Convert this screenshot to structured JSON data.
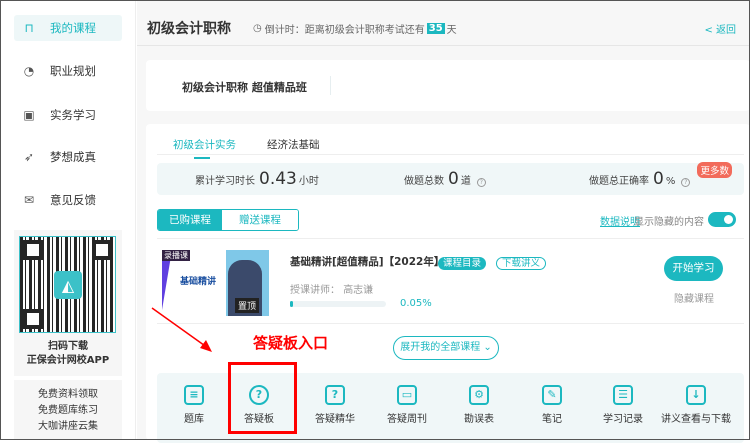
{
  "sidebar": {
    "items": [
      {
        "label": "我的课程",
        "icon": "bookmark-icon",
        "active": true
      },
      {
        "label": "职业规划",
        "icon": "chart-circle-icon"
      },
      {
        "label": "实务学习",
        "icon": "monitor-icon"
      },
      {
        "label": "梦想成真",
        "icon": "paper-plane-icon"
      },
      {
        "label": "意见反馈",
        "icon": "mail-icon"
      }
    ],
    "qr_line1": "扫码下载",
    "qr_line2": "正保会计网校APP",
    "links": [
      "免费资料领取",
      "免费题库练习",
      "大咖讲座云集"
    ]
  },
  "header": {
    "title": "初级会计职称",
    "countdown_prefix": "倒计时：距离初级会计职称考试还有",
    "days": "35",
    "days_suffix": "天",
    "back": "< 返回"
  },
  "class_name": "初级会计职称 超值精品班",
  "tabs": [
    "初级会计实务",
    "经济法基础"
  ],
  "stats": {
    "study_label": "累计学习时长",
    "study_value": "0.43",
    "study_unit": "小时",
    "total_label": "做题总数",
    "total_value": "0",
    "total_unit": "道",
    "rate_label": "做题总正确率",
    "rate_value": "0",
    "rate_unit": "%",
    "more": "更多数"
  },
  "segments": [
    "已购课程",
    "赠送课程"
  ],
  "data_link": "数据说明",
  "show_hidden": "显示隐藏的内容",
  "show_hidden_on": true,
  "course": {
    "title": "基础精讲[超值精品]【2022年】",
    "tag_catalog": "课程目录",
    "tag_download": "下载讲义",
    "teacher_label": "授课讲师：",
    "teacher": "高志谦",
    "progress": 0.05,
    "progress_text": "0.05%",
    "start": "开始学习",
    "hide": "隐藏课程",
    "thumb_pin": "置顶",
    "thumb_title": "基础精讲",
    "thumb_brand": "录播课"
  },
  "expand": "展开我的全部课程",
  "tools": [
    {
      "label": "题库",
      "icon": "question-bank-icon",
      "glyph": "≡"
    },
    {
      "label": "答疑板",
      "icon": "question-bubble-icon",
      "glyph": "?"
    },
    {
      "label": "答疑精华",
      "icon": "chat-question-icon",
      "glyph": "?"
    },
    {
      "label": "答疑周刊",
      "icon": "journal-icon",
      "glyph": "▭"
    },
    {
      "label": "勘误表",
      "icon": "gear-icon",
      "glyph": "⚙"
    },
    {
      "label": "笔记",
      "icon": "pen-icon",
      "glyph": "✎"
    },
    {
      "label": "学习记录",
      "icon": "record-icon",
      "glyph": "☰"
    },
    {
      "label": "讲义查看与下载",
      "icon": "download-icon",
      "glyph": "↓"
    }
  ],
  "annotation": "答疑板入口",
  "colors": {
    "accent": "#1cb8c0",
    "annotation": "#ff0000",
    "badge": "#f26b5b"
  }
}
